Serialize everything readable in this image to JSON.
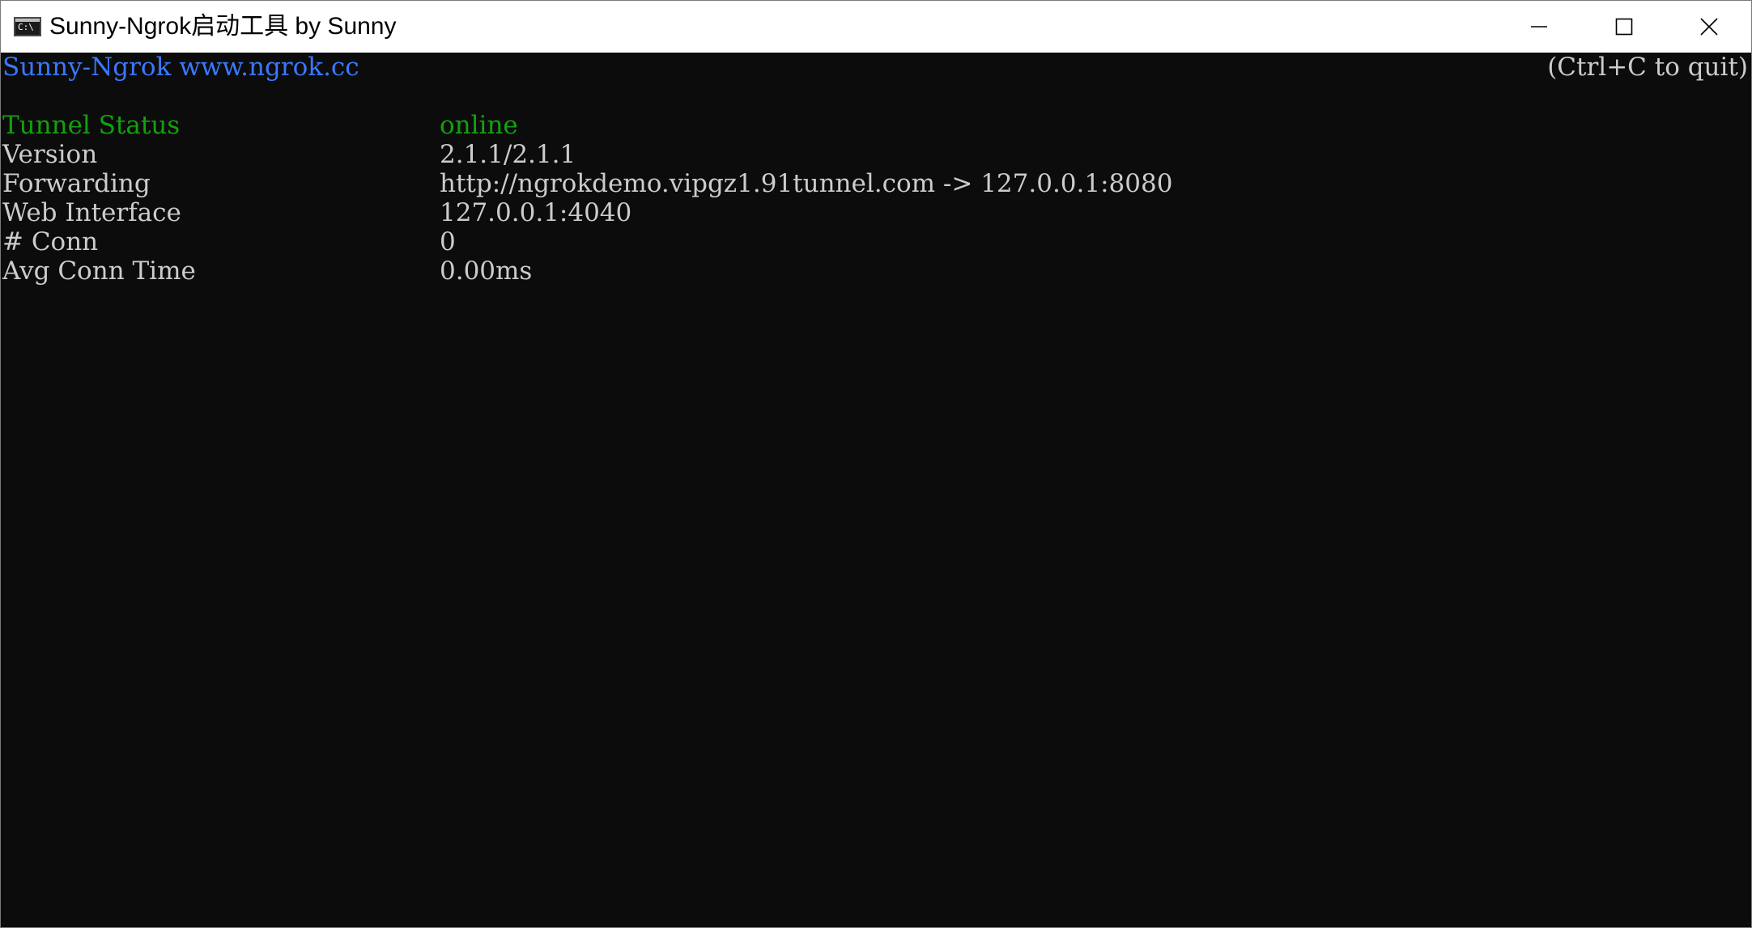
{
  "window": {
    "title": "Sunny-Ngrok启动工具 by Sunny",
    "icon": "cmd-console-icon",
    "controls": {
      "minimize_icon": "minimize-icon",
      "maximize_icon": "maximize-icon",
      "close_icon": "close-icon"
    }
  },
  "console": {
    "header": "Sunny-Ngrok www.ngrok.cc",
    "quit_hint": "(Ctrl+C to quit)",
    "rows": [
      {
        "label": "Tunnel Status",
        "value": "online"
      },
      {
        "label": "Version",
        "value": "2.1.1/2.1.1"
      },
      {
        "label": "Forwarding",
        "value": "http://ngrokdemo.vipgz1.91tunnel.com -> 127.0.0.1:8080"
      },
      {
        "label": "Web Interface",
        "value": "127.0.0.1:4040"
      },
      {
        "label": "# Conn",
        "value": "0"
      },
      {
        "label": "Avg Conn Time",
        "value": "0.00ms"
      }
    ]
  },
  "colors": {
    "background": "#0c0c0c",
    "text": "#cccccc",
    "header_blue": "#3b78ff",
    "status_green": "#13a10e"
  }
}
